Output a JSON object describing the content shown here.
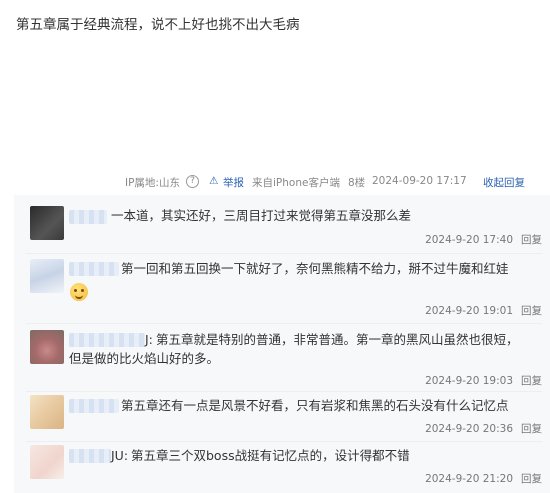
{
  "post": {
    "text": "第五章属于经典流程，说不上好也挑不出大毛病"
  },
  "meta": {
    "ip": "IP属地:山东",
    "help_icon": "?",
    "report_icon": "⚠",
    "report": "举报",
    "client": "来自iPhone客户端",
    "floor": "8楼",
    "time": "2024-09-20 17:17",
    "collapse": "收起回复"
  },
  "replies": [
    {
      "prefix": "",
      "text": "一本道，其实还好，三周目打过来觉得第五章没那么差",
      "text2": "",
      "time": "2024-9-20 17:40",
      "reply": "回复"
    },
    {
      "prefix": "",
      "text": "第一回和第五回换一下就好了，奈何黑熊精不给力，掰不过牛魔和红娃",
      "text2": "",
      "emoji": "smile-emoji",
      "time": "2024-9-20 19:01",
      "reply": "回复"
    },
    {
      "prefix": "J:",
      "text": "第五章就是特别的普通，非常普通。第一章的黑风山虽然也很短，",
      "text2": "但是做的比火焰山好的多。",
      "time": "2024-9-20 19:03",
      "reply": "回复"
    },
    {
      "prefix": "",
      "text": "第五章还有一点是风景不好看，只有岩浆和焦黑的石头没有什么记忆点",
      "text2": "",
      "time": "2024-9-20 20:36",
      "reply": "回复"
    },
    {
      "prefix": "JU:",
      "text": "第五章三个双boss战挺有记忆点的，设计得都不错",
      "text2": "",
      "time": "2024-9-20 21:20",
      "reply": "回复"
    }
  ]
}
